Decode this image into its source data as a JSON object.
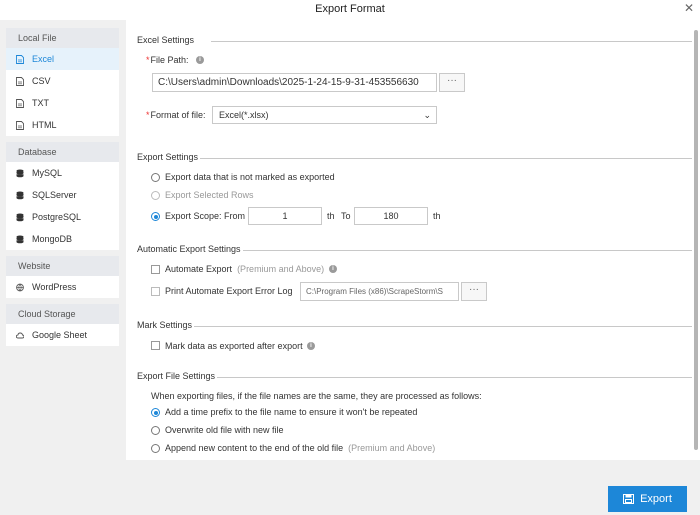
{
  "window": {
    "title": "Export Format",
    "close_glyph": "✕"
  },
  "sidebar": {
    "groups": [
      {
        "title": "Local File",
        "items": [
          {
            "label": "Excel",
            "icon": "file-icon",
            "active": true
          },
          {
            "label": "CSV",
            "icon": "file-icon"
          },
          {
            "label": "TXT",
            "icon": "file-icon"
          },
          {
            "label": "HTML",
            "icon": "file-icon"
          }
        ]
      },
      {
        "title": "Database",
        "items": [
          {
            "label": "MySQL",
            "icon": "database-icon"
          },
          {
            "label": "SQLServer",
            "icon": "database-icon"
          },
          {
            "label": "PostgreSQL",
            "icon": "database-icon"
          },
          {
            "label": "MongoDB",
            "icon": "database-icon"
          }
        ]
      },
      {
        "title": "Website",
        "items": [
          {
            "label": "WordPress",
            "icon": "globe-icon"
          }
        ]
      },
      {
        "title": "Cloud Storage",
        "items": [
          {
            "label": "Google Sheet",
            "icon": "cloud-icon"
          }
        ]
      }
    ]
  },
  "excel_settings": {
    "title": "Excel Settings",
    "required_mark": "*",
    "file_path_label": "File Path:",
    "file_path_value": "C:\\Users\\admin\\Downloads\\2025-1-24-15-9-31-453556630",
    "browse_label": "···",
    "format_label": "Format of file:",
    "format_value": "Excel(*.xlsx)",
    "chevron": "⌄"
  },
  "export_settings": {
    "title": "Export Settings",
    "option_unmarked": "Export data that is not marked as exported",
    "option_selected": "Export Selected Rows",
    "option_scope": "Export Scope: From",
    "from_value": "1",
    "th_label": "th",
    "to_label": "To",
    "to_value": "180",
    "selected_option": "scope"
  },
  "automatic_export": {
    "title": "Automatic Export Settings",
    "automate_label": "Automate Export",
    "automate_hint": "(Premium and Above)",
    "error_log_label": "Print Automate Export Error Log",
    "error_log_path": "C:\\Program Files (x86)\\ScrapeStorm\\S",
    "browse_label": "···"
  },
  "mark_settings": {
    "title": "Mark Settings",
    "mark_label": "Mark data as exported after export"
  },
  "export_file_settings": {
    "title": "Export File Settings",
    "description": "When exporting files, if the file names are the same, they are processed as follows:",
    "option_prefix": "Add a time prefix to the file name to ensure it won't be repeated",
    "option_overwrite": "Overwrite old file with new file",
    "option_append": "Append new content to the end of the old file",
    "append_hint": "(Premium and Above)",
    "selected_option": "prefix"
  },
  "footer": {
    "export_label": "Export"
  },
  "colors": {
    "accent": "#1d87d8",
    "required": "#e33333"
  }
}
